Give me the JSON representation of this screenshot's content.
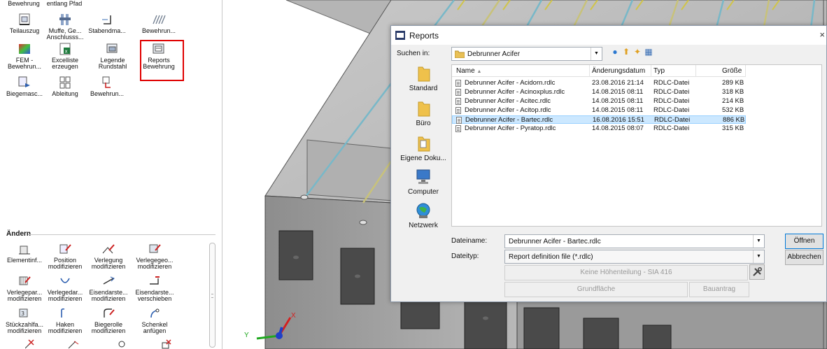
{
  "palette": {
    "top_row": [
      "Bewehrung",
      "entlang Pfad"
    ],
    "tools": [
      {
        "id": "teilauszug",
        "label": "Teilauszug"
      },
      {
        "id": "muffe",
        "label": "Muffe, Ge...\nAnschlusss..."
      },
      {
        "id": "stabendma",
        "label": "Stabendma..."
      },
      {
        "id": "bewehrun1",
        "label": "Bewehrun..."
      },
      {
        "id": "fem",
        "label": "FEM -\nBewehrun..."
      },
      {
        "id": "excelliste",
        "label": "Excelliste\nerzeugen"
      },
      {
        "id": "legende",
        "label": "Legende\nRundstahl"
      },
      {
        "id": "reports",
        "label": "Reports\nBewehrung"
      },
      {
        "id": "biegemasc",
        "label": "Biegemasc..."
      },
      {
        "id": "ableitung",
        "label": "Ableitung"
      },
      {
        "id": "bewehrun2",
        "label": "Bewehrun..."
      }
    ],
    "section_title": "Ändern",
    "modify_tools": [
      {
        "id": "elementinf",
        "label": "Elementinf..."
      },
      {
        "id": "position",
        "label": "Position\nmodifizieren"
      },
      {
        "id": "verlegung",
        "label": "Verlegung\nmodifizieren"
      },
      {
        "id": "verlegegeo",
        "label": "Verlegegeo...\nmodifizieren"
      },
      {
        "id": "verlegepar",
        "label": "Verlegepar...\nmodifizieren"
      },
      {
        "id": "verlegedar",
        "label": "Verlegedar...\nmodifizieren"
      },
      {
        "id": "eisendarste1",
        "label": "Eisendarste...\nmodifizieren"
      },
      {
        "id": "eisendarste2",
        "label": "Eisendarste...\nverschieben"
      },
      {
        "id": "stueckzahl",
        "label": "Stückzahlfa...\nmodifizieren"
      },
      {
        "id": "haken",
        "label": "Haken\nmodifizieren"
      },
      {
        "id": "biegerolle",
        "label": "Biegerolle\nmodifizieren"
      },
      {
        "id": "schenkel",
        "label": "Schenkel\nanfügen"
      }
    ]
  },
  "dialog": {
    "title": "Reports",
    "close_glyph": "×",
    "look_in_label": "Suchen in:",
    "look_in_value": "Debrunner Acifer",
    "places": [
      "Standard",
      "Büro",
      "Eigene Doku...",
      "Computer",
      "Netzwerk"
    ],
    "columns": {
      "name": "Name",
      "date": "Änderungsdatum",
      "type": "Typ",
      "size": "Größe"
    },
    "files": [
      {
        "name": "Debrunner Acifer - Acidorn.rdlc",
        "date": "23.08.2016 21:14",
        "type": "RDLC-Datei",
        "size": "289 KB"
      },
      {
        "name": "Debrunner Acifer - Acinoxplus.rdlc",
        "date": "14.08.2015 08:11",
        "type": "RDLC-Datei",
        "size": "318 KB"
      },
      {
        "name": "Debrunner Acifer - Acitec.rdlc",
        "date": "14.08.2015 08:11",
        "type": "RDLC-Datei",
        "size": "214 KB"
      },
      {
        "name": "Debrunner Acifer - Acitop.rdlc",
        "date": "14.08.2015 08:11",
        "type": "RDLC-Datei",
        "size": "532 KB"
      },
      {
        "name": "Debrunner Acifer - Bartec.rdlc",
        "date": "16.08.2016 15:51",
        "type": "RDLC-Datei",
        "size": "886 KB"
      },
      {
        "name": "Debrunner Acifer - Pyratop.rdlc",
        "date": "14.08.2015 08:07",
        "type": "RDLC-Datei",
        "size": "315 KB"
      }
    ],
    "selected_index": 4,
    "filename_label": "Dateiname:",
    "filename_value": "Debrunner Acifer - Bartec.rdlc",
    "filetype_label": "Dateityp:",
    "filetype_value": "Report definition file (*.rdlc)",
    "open_button": "Öffnen",
    "cancel_button": "Abbrechen",
    "height_division_button": "Keine Höhenteilung - SIA 416",
    "floor_area_button": "Grundfläche",
    "building_app_button": "Bauantrag"
  },
  "viewport": {
    "axis_y": "Y",
    "axis_x": "X"
  }
}
